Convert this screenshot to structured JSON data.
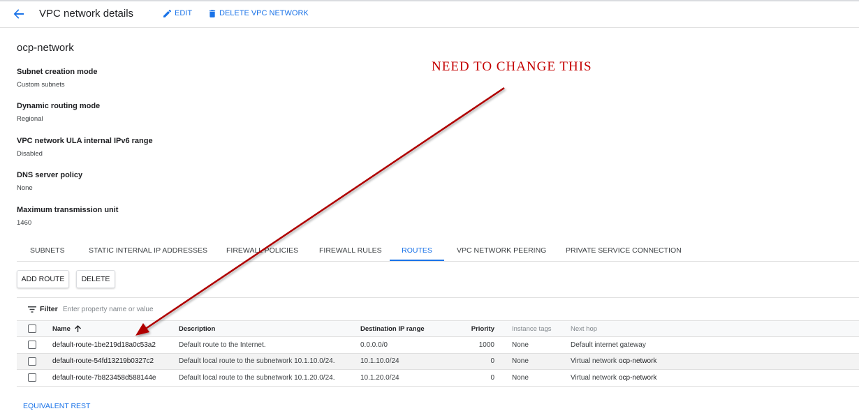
{
  "header": {
    "title": "VPC network details",
    "edit_label": "EDIT",
    "delete_label": "DELETE VPC NETWORK"
  },
  "network": {
    "name": "ocp-network",
    "properties": [
      {
        "label": "Subnet creation mode",
        "value": "Custom subnets"
      },
      {
        "label": "Dynamic routing mode",
        "value": "Regional"
      },
      {
        "label": "VPC network ULA internal IPv6 range",
        "value": "Disabled"
      },
      {
        "label": "DNS server policy",
        "value": "None"
      },
      {
        "label": "Maximum transmission unit",
        "value": "1460"
      }
    ]
  },
  "annotation": {
    "text": "NEED TO CHANGE THIS",
    "color": "#c40000"
  },
  "tabs": [
    {
      "label": "SUBNETS",
      "active": false
    },
    {
      "label": "STATIC INTERNAL IP ADDRESSES",
      "active": false
    },
    {
      "label": "FIREWALL POLICIES",
      "active": false
    },
    {
      "label": "FIREWALL RULES",
      "active": false
    },
    {
      "label": "ROUTES",
      "active": true
    },
    {
      "label": "VPC NETWORK PEERING",
      "active": false
    },
    {
      "label": "PRIVATE SERVICE CONNECTION",
      "active": false
    }
  ],
  "actions": {
    "add_route": "ADD ROUTE",
    "delete": "DELETE"
  },
  "filter": {
    "label": "Filter",
    "placeholder": "Enter property name or value"
  },
  "table": {
    "headers": {
      "name": "Name",
      "description": "Description",
      "destination": "Destination IP range",
      "priority": "Priority",
      "instance_tags": "Instance tags",
      "next_hop": "Next hop"
    },
    "rows": [
      {
        "name": "default-route-1be219d18a0c53a2",
        "description": "Default route to the Internet.",
        "destination": "0.0.0.0/0",
        "priority": "1000",
        "instance_tags": "None",
        "next_hop_prefix": "Default internet gateway",
        "next_hop_link": ""
      },
      {
        "name": "default-route-54fd13219b0327c2",
        "description": "Default local route to the subnetwork 10.1.10.0/24.",
        "destination": "10.1.10.0/24",
        "priority": "0",
        "instance_tags": "None",
        "next_hop_prefix": "Virtual network",
        "next_hop_link": "ocp-network"
      },
      {
        "name": "default-route-7b823458d588144e",
        "description": "Default local route to the subnetwork 10.1.20.0/24.",
        "destination": "10.1.20.0/24",
        "priority": "0",
        "instance_tags": "None",
        "next_hop_prefix": "Virtual network",
        "next_hop_link": "ocp-network"
      }
    ]
  },
  "footer": {
    "equivalent_rest": "EQUIVALENT REST"
  },
  "colors": {
    "accent": "#1a73e8",
    "annotation": "#c40000"
  }
}
